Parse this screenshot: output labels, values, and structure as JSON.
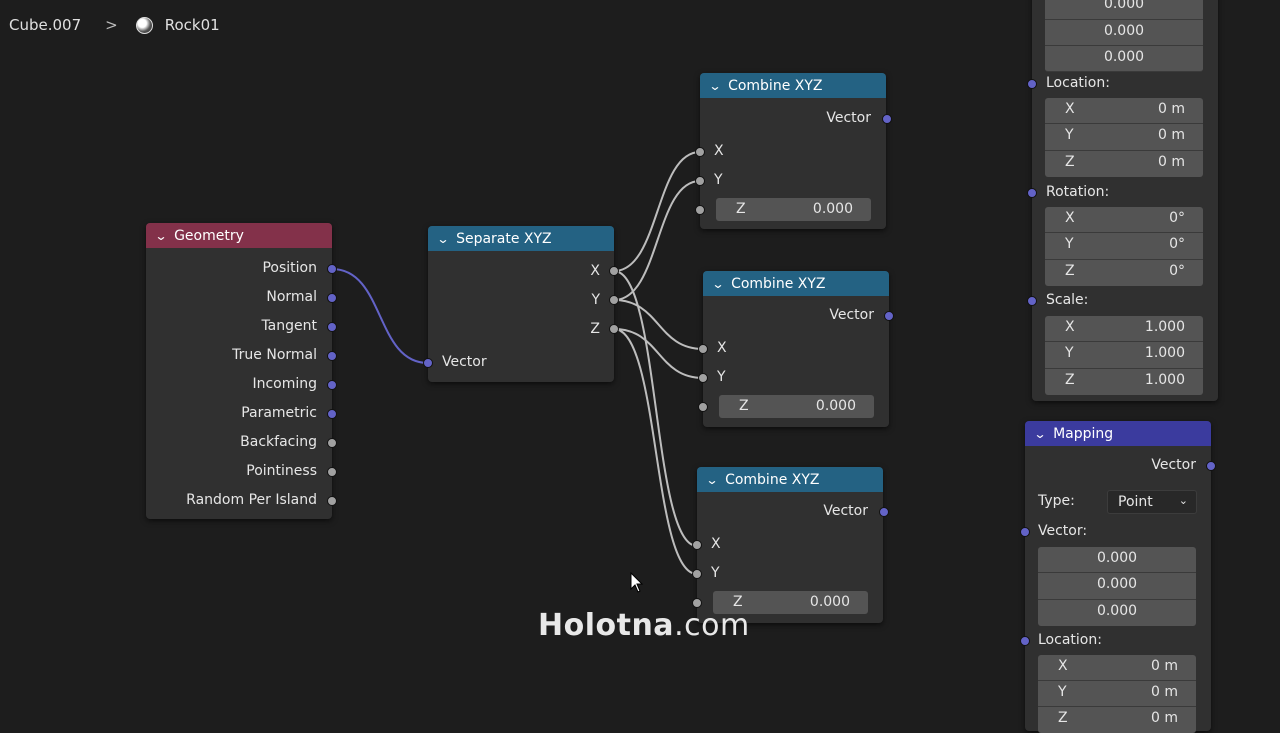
{
  "breadcrumb": {
    "object": "Cube.007",
    "separator": ">",
    "material": "Rock01"
  },
  "geometry_node": {
    "title": "Geometry",
    "outputs": [
      "Position",
      "Normal",
      "Tangent",
      "True Normal",
      "Incoming",
      "Parametric",
      "Backfacing",
      "Pointiness",
      "Random Per Island"
    ]
  },
  "separate_node": {
    "title": "Separate XYZ",
    "outputs": [
      "X",
      "Y",
      "Z"
    ],
    "input": "Vector"
  },
  "combine_nodes": [
    {
      "title": "Combine XYZ",
      "output": "Vector",
      "x": "X",
      "y": "Y",
      "z_label": "Z",
      "z_value": "0.000"
    },
    {
      "title": "Combine XYZ",
      "output": "Vector",
      "x": "X",
      "y": "Y",
      "z_label": "Z",
      "z_value": "0.000"
    },
    {
      "title": "Combine XYZ",
      "output": "Vector",
      "x": "X",
      "y": "Y",
      "z_label": "Z",
      "z_value": "0.000"
    }
  ],
  "mapping_top": {
    "vector_values": [
      "0.000",
      "0.000",
      "0.000"
    ],
    "location_label": "Location:",
    "location": [
      {
        "axis": "X",
        "value": "0 m"
      },
      {
        "axis": "Y",
        "value": "0 m"
      },
      {
        "axis": "Z",
        "value": "0 m"
      }
    ],
    "rotation_label": "Rotation:",
    "rotation": [
      {
        "axis": "X",
        "value": "0°"
      },
      {
        "axis": "Y",
        "value": "0°"
      },
      {
        "axis": "Z",
        "value": "0°"
      }
    ],
    "scale_label": "Scale:",
    "scale": [
      {
        "axis": "X",
        "value": "1.000"
      },
      {
        "axis": "Y",
        "value": "1.000"
      },
      {
        "axis": "Z",
        "value": "1.000"
      }
    ]
  },
  "mapping_node": {
    "title": "Mapping",
    "output": "Vector",
    "type_label": "Type:",
    "type_value": "Point",
    "vector_label": "Vector:",
    "vector_values": [
      "0.000",
      "0.000",
      "0.000"
    ],
    "location_label": "Location:",
    "location": [
      {
        "axis": "X",
        "value": "0 m"
      },
      {
        "axis": "Y",
        "value": "0 m"
      },
      {
        "axis": "Z",
        "value": "0 m"
      }
    ]
  },
  "watermark": {
    "bold": "Holotna",
    "rest": ".com"
  },
  "colors": {
    "background": "#1d1d1d",
    "node_body": "#303030",
    "input_header": "#83314a",
    "converter_header": "#246283",
    "vector_header": "#3b3b9e",
    "vector_socket": "#6363c7",
    "float_socket": "#a1a1a1"
  }
}
